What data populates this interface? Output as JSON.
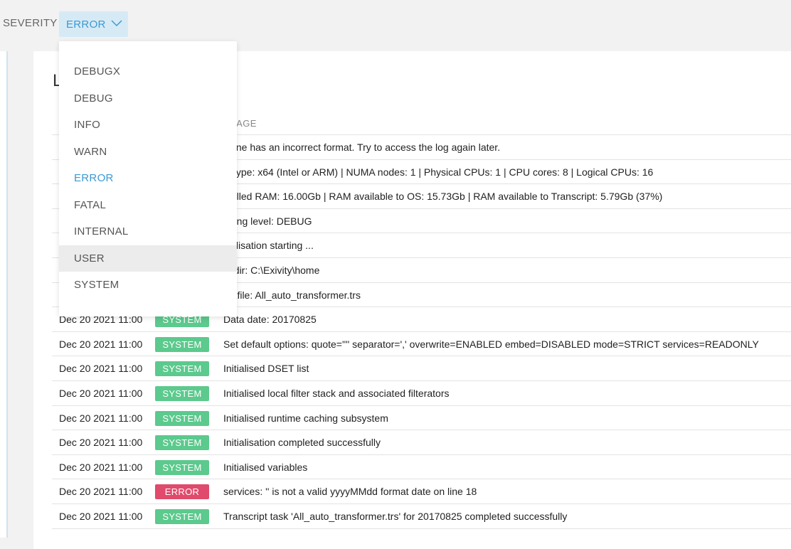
{
  "filter": {
    "label": "SEVERITY",
    "selected": "ERROR"
  },
  "dropdown": {
    "options": [
      "DEBUGX",
      "DEBUG",
      "INFO",
      "WARN",
      "ERROR",
      "FATAL",
      "INTERNAL",
      "USER",
      "SYSTEM"
    ],
    "selected": "ERROR",
    "hovered": "USER"
  },
  "card": {
    "title": "L"
  },
  "table": {
    "headers": {
      "message": "SSAGE"
    },
    "rows": [
      {
        "date": "",
        "severity": "",
        "message": "g line has an incorrect format. Try to access the log again later."
      },
      {
        "date": "",
        "severity": "",
        "message": "U type: x64 (Intel or ARM) | NUMA nodes: 1 | Physical CPUs: 1 | CPU cores: 8 | Logical CPUs: 16"
      },
      {
        "date": "",
        "severity": "",
        "message": "stalled RAM: 16.00Gb | RAM available to OS: 15.73Gb | RAM available to Transcript: 5.79Gb (37%)"
      },
      {
        "date": "",
        "severity": "",
        "message": "gging level: DEBUG"
      },
      {
        "date": "",
        "severity": "",
        "message": "itialisation starting ..."
      },
      {
        "date": "",
        "severity": "",
        "message": "sedir: C:\\Exivity\\home"
      },
      {
        "date": "",
        "severity": "",
        "message": "riptfile: All_auto_transformer.trs"
      },
      {
        "date": "Dec 20 2021 11:00",
        "severity": "SYSTEM",
        "message": "Data date: 20170825"
      },
      {
        "date": "Dec 20 2021 11:00",
        "severity": "SYSTEM",
        "message": "Set default options: quote='\"' separator=',' overwrite=ENABLED embed=DISABLED mode=STRICT services=READONLY"
      },
      {
        "date": "Dec 20 2021 11:00",
        "severity": "SYSTEM",
        "message": "Initialised DSET list"
      },
      {
        "date": "Dec 20 2021 11:00",
        "severity": "SYSTEM",
        "message": "Initialised local filter stack and associated filterators"
      },
      {
        "date": "Dec 20 2021 11:00",
        "severity": "SYSTEM",
        "message": "Initialised runtime caching subsystem"
      },
      {
        "date": "Dec 20 2021 11:00",
        "severity": "SYSTEM",
        "message": "Initialisation completed successfully"
      },
      {
        "date": "Dec 20 2021 11:00",
        "severity": "SYSTEM",
        "message": "Initialised variables"
      },
      {
        "date": "Dec 20 2021 11:00",
        "severity": "ERROR",
        "message": "services: '' is not a valid yyyyMMdd format date on line 18"
      },
      {
        "date": "Dec 20 2021 11:00",
        "severity": "SYSTEM",
        "message": "Transcript task 'All_auto_transformer.trs' for 20170825 completed successfully"
      }
    ]
  },
  "colors": {
    "system_badge": "#5cc98d",
    "error_badge": "#e04a6c",
    "accent": "#3a9ad3"
  }
}
